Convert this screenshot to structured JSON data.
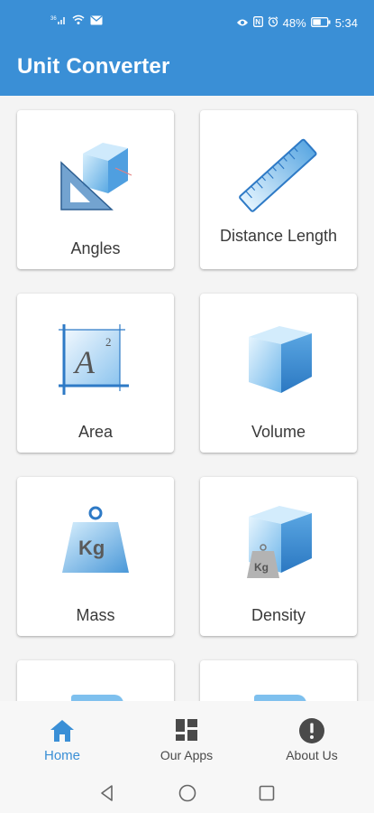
{
  "status_bar": {
    "signal_text": "36",
    "battery_percent": "48%",
    "time": "5:34",
    "icons": [
      "signal-icon",
      "wifi-icon",
      "mail-icon",
      "eye-icon",
      "nfc-icon",
      "alarm-icon",
      "battery-icon"
    ]
  },
  "app_bar": {
    "title": "Unit Converter"
  },
  "categories": [
    {
      "label": "Angles",
      "icon": "angles-icon"
    },
    {
      "label": "Distance Length",
      "icon": "ruler-icon"
    },
    {
      "label": "Area",
      "icon": "area-icon"
    },
    {
      "label": "Volume",
      "icon": "cube-icon"
    },
    {
      "label": "Mass",
      "icon": "weight-icon",
      "badge": "Kg"
    },
    {
      "label": "Density",
      "icon": "density-icon",
      "badge": "Kg"
    }
  ],
  "area_glyph": {
    "letter": "A",
    "exponent": "2"
  },
  "bottom_nav": [
    {
      "label": "Home",
      "icon": "home-icon",
      "active": true
    },
    {
      "label": "Our Apps",
      "icon": "apps-grid-icon",
      "active": false
    },
    {
      "label": "About Us",
      "icon": "info-icon",
      "active": false
    }
  ],
  "system_nav": [
    "back-icon",
    "home-circle-icon",
    "recents-icon"
  ],
  "colors": {
    "primary": "#3a8fd6",
    "card_bg": "#ffffff",
    "page_bg": "#f4f4f4",
    "icon_blue": "#6bb8ec"
  }
}
